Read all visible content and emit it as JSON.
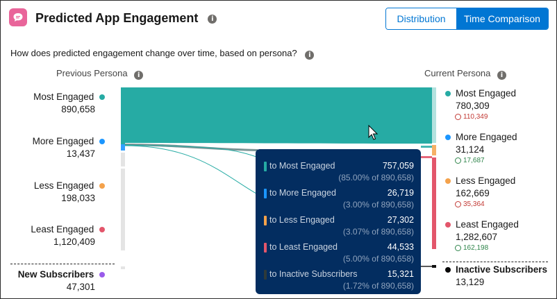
{
  "header": {
    "title": "Predicted App Engagement",
    "toggle": {
      "distribution_label": "Distribution",
      "time_label": "Time Comparison",
      "selected": "Time Comparison"
    }
  },
  "question": "How does predicted engagement change over time, based on persona?",
  "previous": {
    "heading": "Previous Persona",
    "items": [
      {
        "label": "Most Engaged",
        "value": "890,658",
        "color": "#26aba4"
      },
      {
        "label": "More Engaged",
        "value": "13,437",
        "color": "#1b96ff"
      },
      {
        "label": "Less Engaged",
        "value": "198,033",
        "color": "#f4a24b"
      },
      {
        "label": "Least Engaged",
        "value": "1,120,409",
        "color": "#e3566b"
      }
    ],
    "new": {
      "label": "New Subscribers",
      "value": "47,301",
      "color": "#9a5bea"
    }
  },
  "current": {
    "heading": "Current Persona",
    "items": [
      {
        "label": "Most Engaged",
        "value": "780,309",
        "delta": "110,349",
        "direction": "down",
        "color": "#26aba4"
      },
      {
        "label": "More Engaged",
        "value": "31,124",
        "delta": "17,687",
        "direction": "up",
        "color": "#1b96ff"
      },
      {
        "label": "Less Engaged",
        "value": "162,669",
        "delta": "35,364",
        "direction": "down",
        "color": "#f4a24b"
      },
      {
        "label": "Least Engaged",
        "value": "1,282,607",
        "delta": "162,198",
        "direction": "up",
        "color": "#e3566b"
      }
    ],
    "inactive": {
      "label": "Inactive Subscribers",
      "value": "13,129",
      "color": "#080707"
    }
  },
  "tooltip": {
    "rows": [
      {
        "label": "to Most Engaged",
        "value": "757,059",
        "pct": "(85.00% of 890,658)",
        "color": "#26aba4"
      },
      {
        "label": "to More Engaged",
        "value": "26,719",
        "pct": "(3.00% of 890,658)",
        "color": "#1b96ff"
      },
      {
        "label": "to Less Engaged",
        "value": "27,302",
        "pct": "(3.07% of 890,658)",
        "color": "#f4a24b"
      },
      {
        "label": "to Least Engaged",
        "value": "44,533",
        "pct": "(5.00% of 890,658)",
        "color": "#e3566b"
      },
      {
        "label": "to Inactive Subscribers",
        "value": "15,321",
        "pct": "(1.72% of 890,658)",
        "color": "#2e3a3a"
      }
    ]
  }
}
